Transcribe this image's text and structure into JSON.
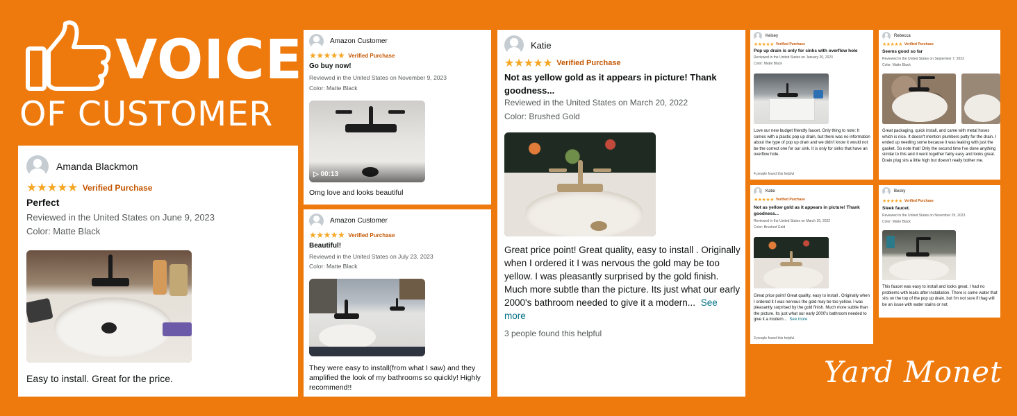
{
  "header": {
    "line1": "VOICE",
    "line2": "OF CUSTOMER",
    "icon": "thumbs-up-icon"
  },
  "brand": "Yard Monet",
  "stars_glyph": "★★★★★",
  "reviews": {
    "r1": {
      "name": "Amanda Blackmon",
      "verified": "Verified Purchase",
      "title": "Perfect",
      "meta": "Reviewed in the United States on June 9, 2023",
      "color": "Color: Matte Black",
      "body": "Easy to install. Great for the price."
    },
    "r2": {
      "name": "Amazon Customer",
      "verified": "Verified Purchase",
      "title": "Go buy now!",
      "meta": "Reviewed in the United States on November 9, 2023",
      "color": "Color: Matte Black",
      "video": "▷ 00:13",
      "body": "Omg love and looks beautiful"
    },
    "r3": {
      "name": "Amazon Customer",
      "verified": "Verified Purchase",
      "title": "Beautiful!",
      "meta": "Reviewed in the United States on July 23, 2023",
      "color": "Color: Matte Black",
      "body": "They were easy to install(from what I saw) and they amplified the look of my bathrooms so quickly! Highly recommend!!"
    },
    "r4": {
      "name": "Katie",
      "verified": "Verified Purchase",
      "title": "Not as yellow gold as it appears in picture! Thank goodness...",
      "meta": "Reviewed in the United States on March 20, 2022",
      "color": "Color: Brushed Gold",
      "body": "Great price point! Great quality, easy to install . Originally when I ordered it I was nervous the gold may be too yellow. I was pleasantly surprised by the gold finish. Much more subtle than the picture. Its just what our early 2000's bathroom needed to give it a modern...",
      "see_more": "See more",
      "helpful": "3 people found this helpful"
    },
    "r5": {
      "name": "Kelsey",
      "verified": "Verified Purchase",
      "title": "Pop up drain is only for sinks with overflow hole",
      "meta": "Reviewed in the United States on January 20, 2023",
      "color": "Color: Matte Black",
      "body": "Love our new budget friendly faucet. Only thing to note: It comes with a plastic pop up drain, but there was no information about the type of pop up drain and we didn't know it would not be the correct one for our sink. It is only for sinks that have an overflow hole.",
      "helpful": "4 people found this helpful"
    },
    "r6": {
      "name": "Rebecca",
      "verified": "Verified Purchase",
      "title": "Seems good so far",
      "meta": "Reviewed in the United States on September 7, 2023",
      "color": "Color: Matte Black",
      "body": "Great packaging, quick install, and came with metal hoses which is nice. It doesn't mention plumbers putty for the drain. I ended up needing some because it was leaking with just the gasket. So note that! Only the second time I've done anything similar to this and it went together fairly easy and looks great. Drain plug sits a little high but doesn't really bother me."
    },
    "r7": {
      "name": "Katie",
      "verified": "Verified Purchase",
      "title": "Not as yellow gold as it appears in picture! Thank goodness...",
      "meta": "Reviewed in the United States on March 20, 2022",
      "color": "Color: Brushed Gold",
      "body": "Great price point! Great quality, easy to install . Originally when I ordered it I was nervous the gold may be too yellow. I was pleasantly surprised by the gold finish. Much more subtle than the picture. Its just what our early 2000's bathroom needed to give it a modern...",
      "see_more": "See more",
      "helpful": "3 people found this helpful"
    },
    "r8": {
      "name": "Becky",
      "verified": "Verified Purchase",
      "title": "Sleek faucet.",
      "meta": "Reviewed in the United States on November 29, 2023",
      "color": "Color: Matte Black",
      "body": "This faucet was easy to install and looks great. I had no problems with leaks after installation. There is some water that sits on the top of the pop up drain, but I'm not sure if thag will be an issue with water stains or not."
    }
  },
  "rating": {
    "stars": 5,
    "max": 5
  },
  "colors": {
    "background": "#ee7a0e",
    "stars": "#f5a623",
    "verified": "#c45500",
    "link": "#007185"
  }
}
